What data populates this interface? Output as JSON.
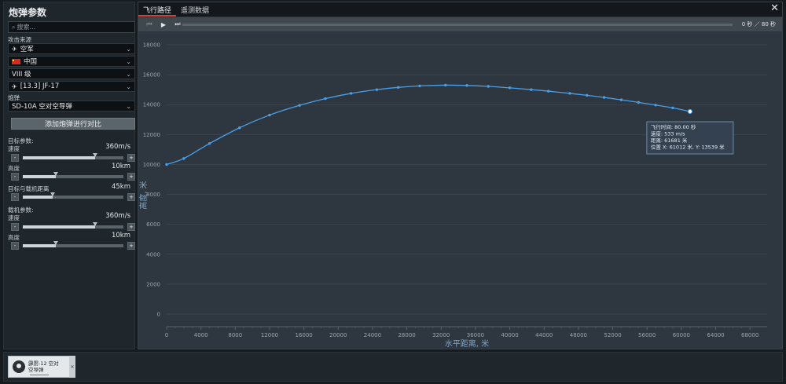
{
  "left": {
    "title": "炮弹参数",
    "search_placeholder": "搜索...",
    "attack_source_label": "攻击来源",
    "source_dropdown": "空军",
    "country_dropdown": "中国",
    "rank_dropdown": "VIII 级",
    "aircraft_dropdown": "[13.3] JF-17",
    "shell_label": "炮弹",
    "shell_dropdown": "SD-10A 空对空导弹",
    "add_compare_button": "添加炮弹进行对比",
    "target_params_label": "目标参数:",
    "target_speed_label": "速度",
    "target_speed_value": "360m/s",
    "target_speed_level": 0.72,
    "target_alt_label": "高度",
    "target_alt_value": "10km",
    "target_alt_level": 0.33,
    "distance_label": "目标与载机距离",
    "distance_value": "45km",
    "distance_level": 0.3,
    "carrier_params_label": "载机参数:",
    "carrier_speed_label": "速度",
    "carrier_speed_value": "360m/s",
    "carrier_speed_level": 0.72,
    "carrier_alt_label": "高度",
    "carrier_alt_value": "10km",
    "carrier_alt_level": 0.33,
    "minus_label": "-",
    "plus_label": "+"
  },
  "tabs": [
    {
      "label": "飞行路径",
      "active": true
    },
    {
      "label": "遥测数据",
      "active": false
    }
  ],
  "player": {
    "time_readout": "0 秒 ／ 80 秒",
    "progress": 0
  },
  "tooltip": {
    "line1": "飞行时间:  80.00 秒",
    "line2": "速度:  533 m/s",
    "line3": "距离:  61681 米",
    "line4": "位置 X:  61012 米,  Y:  13539 米"
  },
  "bottom": {
    "card_label": "霹雳-12 空对空导弹",
    "card_close": "×"
  },
  "colors": {
    "line": "#4a9fe8",
    "accent_tab": "#d4433a"
  },
  "chart_data": {
    "type": "line",
    "xlabel": "水平距离, 米",
    "ylabel": "高度, 米",
    "xlim": [
      0,
      70000
    ],
    "ylim": [
      0,
      18000
    ],
    "x_ticks": [
      0,
      4000,
      8000,
      12000,
      16000,
      20000,
      24000,
      28000,
      32000,
      36000,
      40000,
      44000,
      48000,
      52000,
      56000,
      60000,
      64000,
      68000
    ],
    "y_ticks": [
      0,
      2000,
      4000,
      6000,
      8000,
      10000,
      12000,
      14000,
      16000,
      18000
    ],
    "grid": true,
    "series": [
      {
        "x": [
          0,
          2000,
          5000,
          8500,
          12000,
          15500,
          18500,
          21500,
          24500,
          27000,
          29500,
          32500,
          35000,
          37500,
          40000,
          42500,
          44500,
          47000,
          49000,
          51000,
          53000,
          55000,
          57000,
          59000,
          61012
        ],
        "y": [
          10000,
          10400,
          11400,
          12450,
          13300,
          13950,
          14400,
          14750,
          15000,
          15150,
          15250,
          15300,
          15280,
          15220,
          15120,
          15000,
          14900,
          14750,
          14620,
          14480,
          14320,
          14150,
          13970,
          13780,
          13539
        ]
      }
    ]
  }
}
